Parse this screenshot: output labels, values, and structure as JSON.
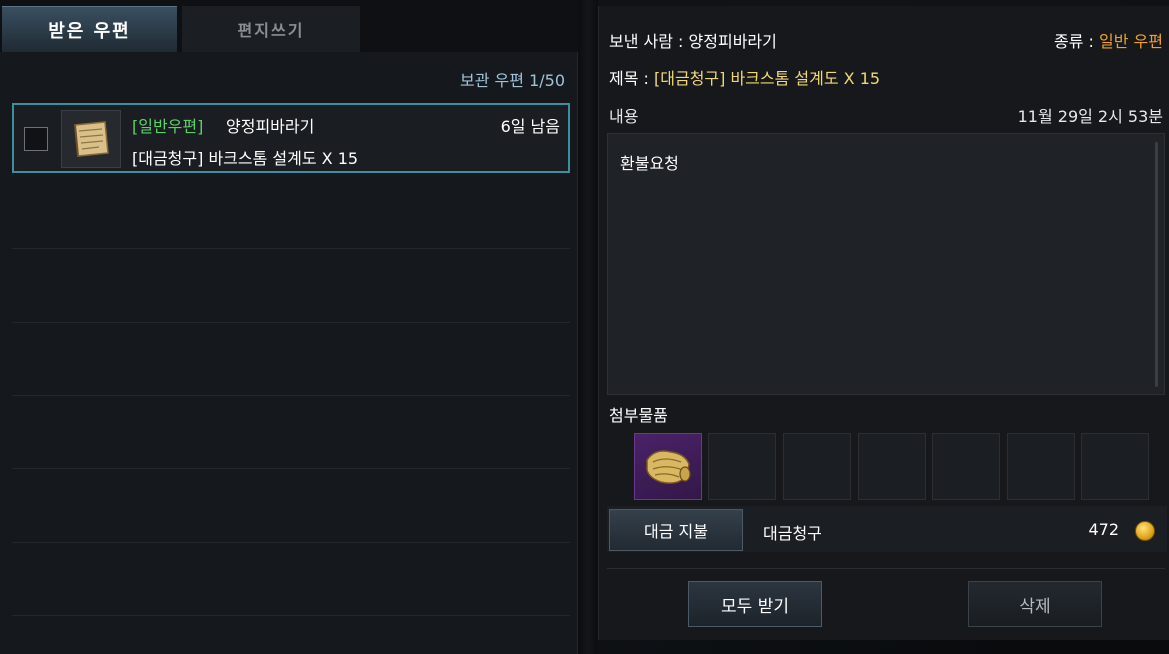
{
  "tabs": {
    "received": "받은 우편",
    "write": "편지쓰기"
  },
  "inbox": {
    "storage_label": "보관 우편 1/50",
    "mails": [
      {
        "type": "[일반우편]",
        "sender": "양정피바라기",
        "remaining": "6일 남음",
        "subject": "[대금청구] 바크스톰 설계도 X 15",
        "thumb_icon": "blueprint-scroll-icon"
      }
    ]
  },
  "detail": {
    "sender_label": "보낸 사람 : ",
    "sender": "양정피바라기",
    "type_label": "종류 : ",
    "type": "일반 우편",
    "title_label": "제목 : ",
    "title": "[대금청구] 바크스톰 설계도 X 15",
    "content_label": "내용",
    "date": "11월 29일 2시 53분",
    "content": "환불요청",
    "attachments_label": "첨부물품",
    "attachment_icon": "blueprint-scroll-icon",
    "cod_button": "대금 지불",
    "cod_label": "대금청구",
    "cod_amount": "472",
    "currency_icon": "gold-coin-icon",
    "receive_all": "모두 받기",
    "delete": "삭제"
  },
  "colors": {
    "accent_border": "#3d8fa0",
    "mail_type_green": "#5fd068",
    "type_orange": "#f0a030",
    "title_yellow": "#f0d878",
    "attachment_purple": "#4a2268"
  }
}
